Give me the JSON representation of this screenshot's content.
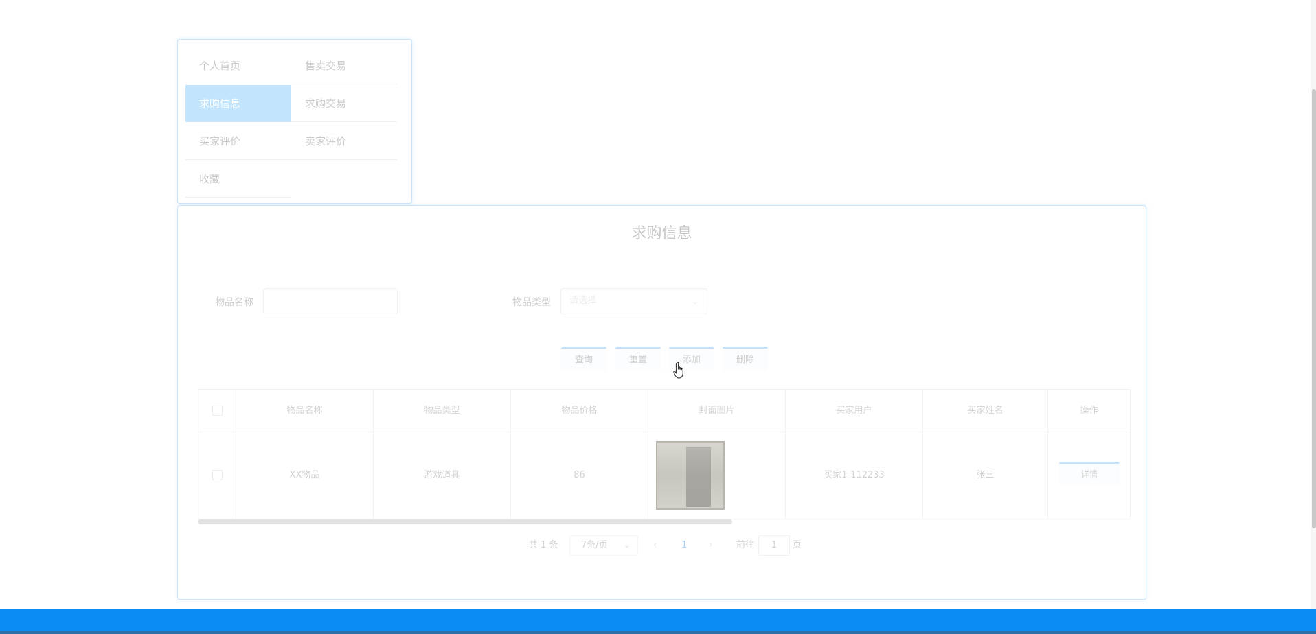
{
  "menu": {
    "items": [
      {
        "label": "个人首页",
        "active": false
      },
      {
        "label": "售卖交易",
        "active": false
      },
      {
        "label": "求购信息",
        "active": true
      },
      {
        "label": "求购交易",
        "active": false
      },
      {
        "label": "买家评价",
        "active": false
      },
      {
        "label": "卖家评价",
        "active": false
      },
      {
        "label": "收藏",
        "active": false
      }
    ]
  },
  "page": {
    "title": "求购信息"
  },
  "search": {
    "name_label": "物品名称",
    "name_value": "",
    "type_label": "物品类型",
    "type_placeholder": "请选择"
  },
  "actions": {
    "query": "查询",
    "reset": "重置",
    "add": "添加",
    "delete": "删除"
  },
  "table": {
    "headers": [
      "物品名称",
      "物品类型",
      "物品价格",
      "封面图片",
      "买家用户",
      "买家姓名",
      "操作"
    ],
    "rows": [
      {
        "name": "XX物品",
        "type": "游戏道具",
        "price": "86",
        "buyer_user": "买家1-112233",
        "buyer_name": "张三",
        "action": "详情"
      }
    ]
  },
  "pagination": {
    "total": "共 1 条",
    "page_size": "7条/页",
    "prev": "‹",
    "current": "1",
    "next": "›",
    "goto_prefix": "前往",
    "goto_value": "1",
    "goto_suffix": "页"
  },
  "colors": {
    "accent": "#0b8cf4",
    "active_menu": "#c2e4fc"
  }
}
